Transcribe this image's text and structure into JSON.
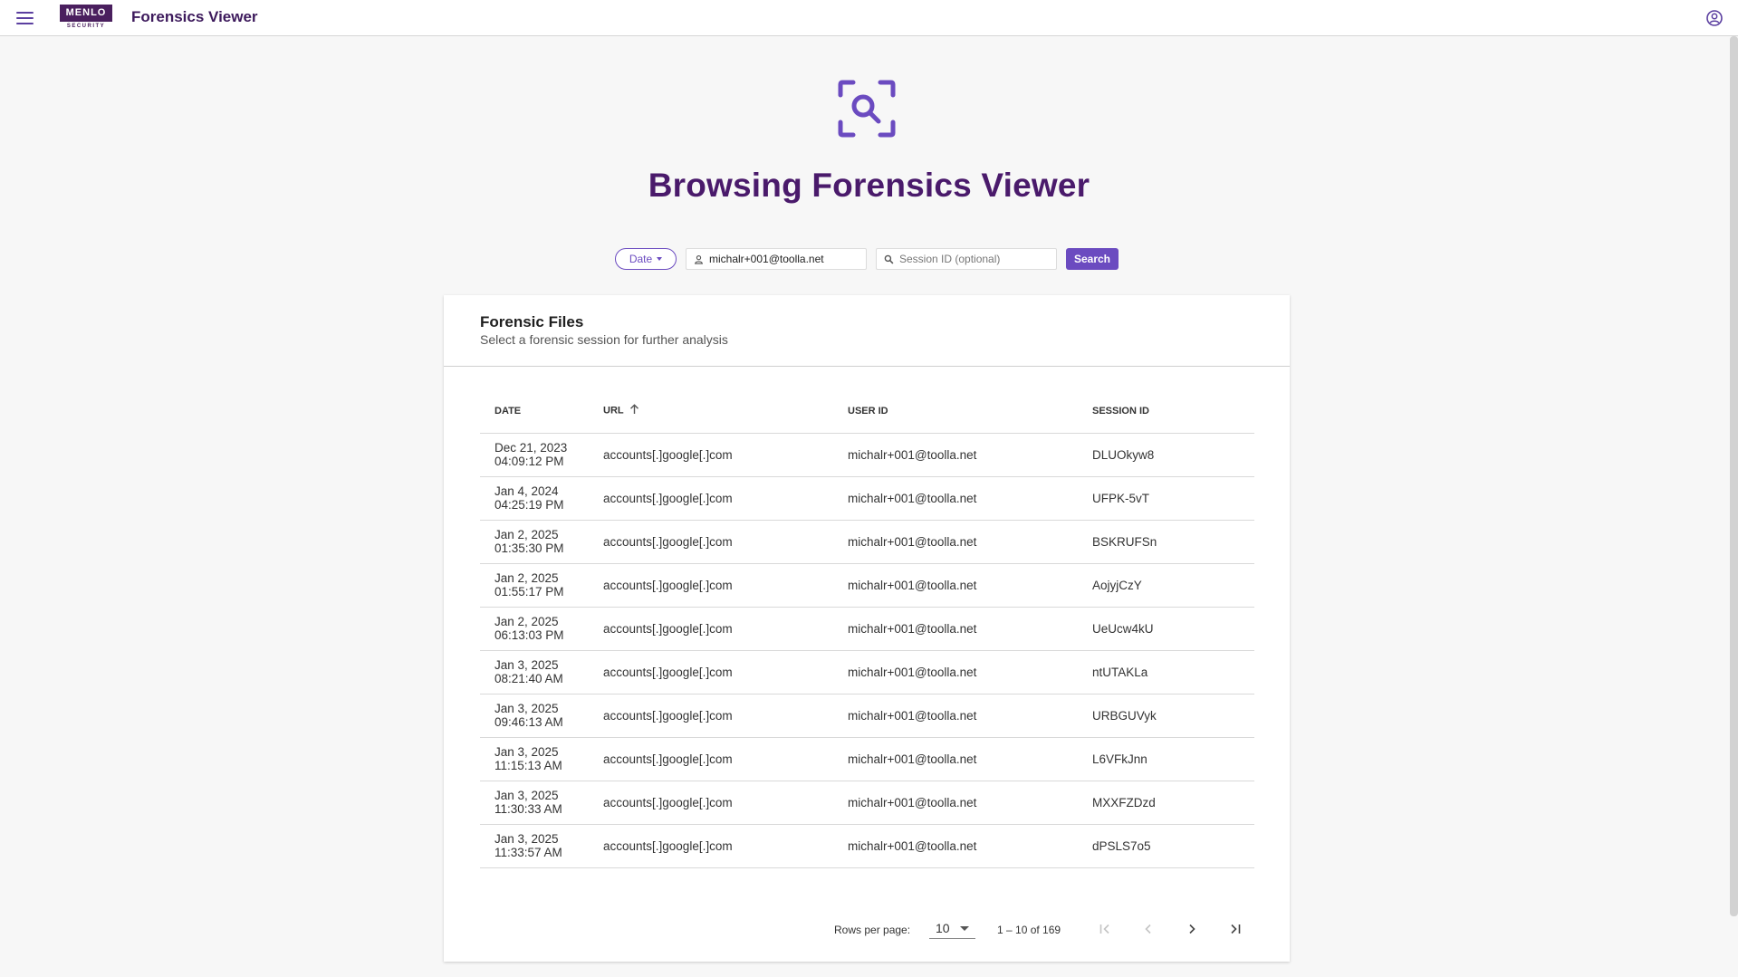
{
  "header": {
    "logo_text": "MENLO",
    "logo_sub": "SECURITY",
    "app_title": "Forensics Viewer"
  },
  "hero": {
    "title": "Browsing Forensics Viewer"
  },
  "search": {
    "date_label": "Date",
    "user_value": "michalr+001@toolla.net",
    "session_placeholder": "Session ID (optional)",
    "button_label": "Search"
  },
  "card": {
    "title": "Forensic Files",
    "subtitle": "Select a forensic session for further analysis"
  },
  "table": {
    "columns": [
      "DATE",
      "URL",
      "USER ID",
      "SESSION ID"
    ],
    "rows": [
      {
        "date": "Dec 21, 2023",
        "time": "04:09:12 PM",
        "url": "accounts[.]google[.]com",
        "user": "michalr+001@toolla.net",
        "session": "DLUOkyw8"
      },
      {
        "date": "Jan 4, 2024",
        "time": "04:25:19 PM",
        "url": "accounts[.]google[.]com",
        "user": "michalr+001@toolla.net",
        "session": "UFPK-5vT"
      },
      {
        "date": "Jan 2, 2025",
        "time": "01:35:30 PM",
        "url": "accounts[.]google[.]com",
        "user": "michalr+001@toolla.net",
        "session": "BSKRUFSn"
      },
      {
        "date": "Jan 2, 2025",
        "time": "01:55:17 PM",
        "url": "accounts[.]google[.]com",
        "user": "michalr+001@toolla.net",
        "session": "AojyjCzY"
      },
      {
        "date": "Jan 2, 2025",
        "time": "06:13:03 PM",
        "url": "accounts[.]google[.]com",
        "user": "michalr+001@toolla.net",
        "session": "UeUcw4kU"
      },
      {
        "date": "Jan 3, 2025",
        "time": "08:21:40 AM",
        "url": "accounts[.]google[.]com",
        "user": "michalr+001@toolla.net",
        "session": "ntUTAKLa"
      },
      {
        "date": "Jan 3, 2025",
        "time": "09:46:13 AM",
        "url": "accounts[.]google[.]com",
        "user": "michalr+001@toolla.net",
        "session": "URBGUVyk"
      },
      {
        "date": "Jan 3, 2025",
        "time": "11:15:13 AM",
        "url": "accounts[.]google[.]com",
        "user": "michalr+001@toolla.net",
        "session": "L6VFkJnn"
      },
      {
        "date": "Jan 3, 2025",
        "time": "11:30:33 AM",
        "url": "accounts[.]google[.]com",
        "user": "michalr+001@toolla.net",
        "session": "MXXFZDzd"
      },
      {
        "date": "Jan 3, 2025",
        "time": "11:33:57 AM",
        "url": "accounts[.]google[.]com",
        "user": "michalr+001@toolla.net",
        "session": "dPSLS7o5"
      }
    ]
  },
  "paginator": {
    "rows_per_page_label": "Rows per page:",
    "rows_per_page_value": "10",
    "range_label": "1 – 10 of 169"
  },
  "icons": {
    "menu": "menu-icon",
    "account": "account-circle-icon",
    "hero": "search-scan-icon",
    "user_field": "person-icon",
    "session_field": "search-icon",
    "sort": "arrow-up-icon",
    "first": "first-page-icon",
    "prev": "chevron-left-icon",
    "next": "chevron-right-icon",
    "last": "last-page-icon"
  },
  "colors": {
    "accent": "#6b4bc0",
    "brand_dark": "#4a1a6b",
    "logo_bg": "#4a1f5e"
  }
}
